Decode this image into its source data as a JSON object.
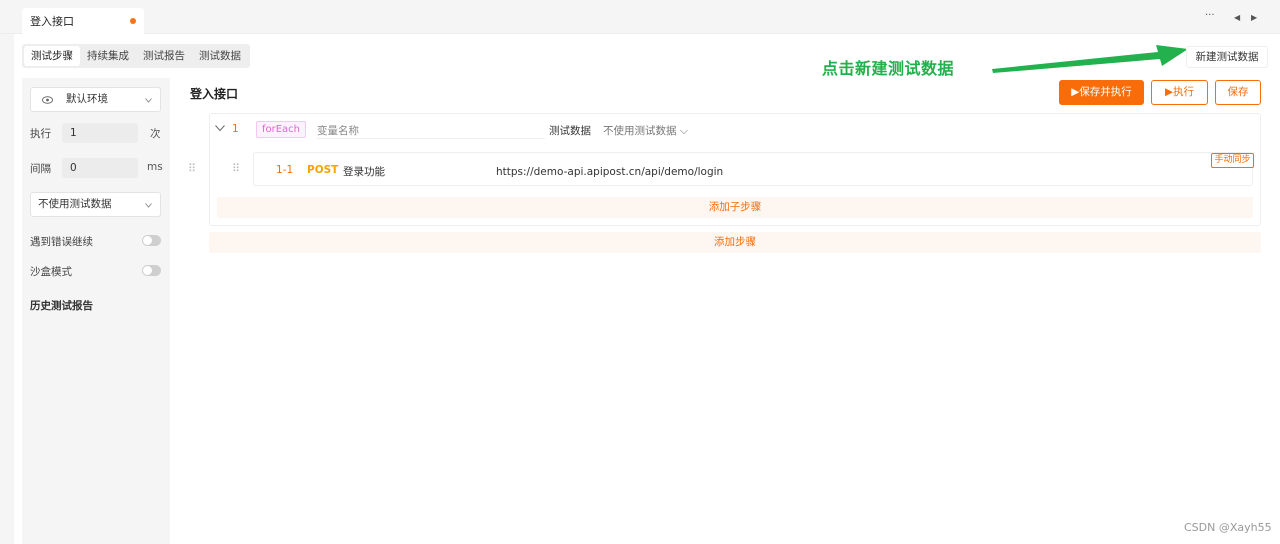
{
  "tab": {
    "title": "登入接口"
  },
  "window_controls": {
    "more": "···",
    "prev": "◀",
    "next": "▶"
  },
  "subtabs": [
    "测试步骤",
    "持续集成",
    "测试报告",
    "测试数据"
  ],
  "sidebar": {
    "env_icon": "eye-icon",
    "env_label": "默认环境",
    "exec_label": "执行",
    "exec_value": "1",
    "exec_unit": "次",
    "interval_label": "间隔",
    "interval_value": "0",
    "interval_unit": "ms",
    "test_data_select": "不使用测试数据",
    "continue_on_error": "遇到错误继续",
    "sandbox_mode": "沙盒模式",
    "history_reports": "历史测试报告"
  },
  "main": {
    "title": "登入接口",
    "annotation": "点击新建测试数据",
    "new_test_data_button": "新建测试数据",
    "buttons": {
      "save_and_run": "▶保存并执行",
      "run": "▶执行",
      "save": "保存"
    },
    "step": {
      "index": "1",
      "type_tag": "forEach",
      "var_placeholder": "变量名称",
      "test_data_label": "测试数据",
      "test_data_value": "不使用测试数据 ⌵",
      "sub_step": {
        "index": "1-1",
        "method": "POST",
        "name": "登录功能",
        "url": "https://demo-api.apipost.cn/api/demo/login",
        "sync_label": "手动同步"
      },
      "add_sub_step": "添加子步骤"
    },
    "add_step": "添加步骤"
  },
  "watermark": "CSDN @Xayh55",
  "colors": {
    "accent": "#f86d0a",
    "annotation": "#22b14c"
  }
}
